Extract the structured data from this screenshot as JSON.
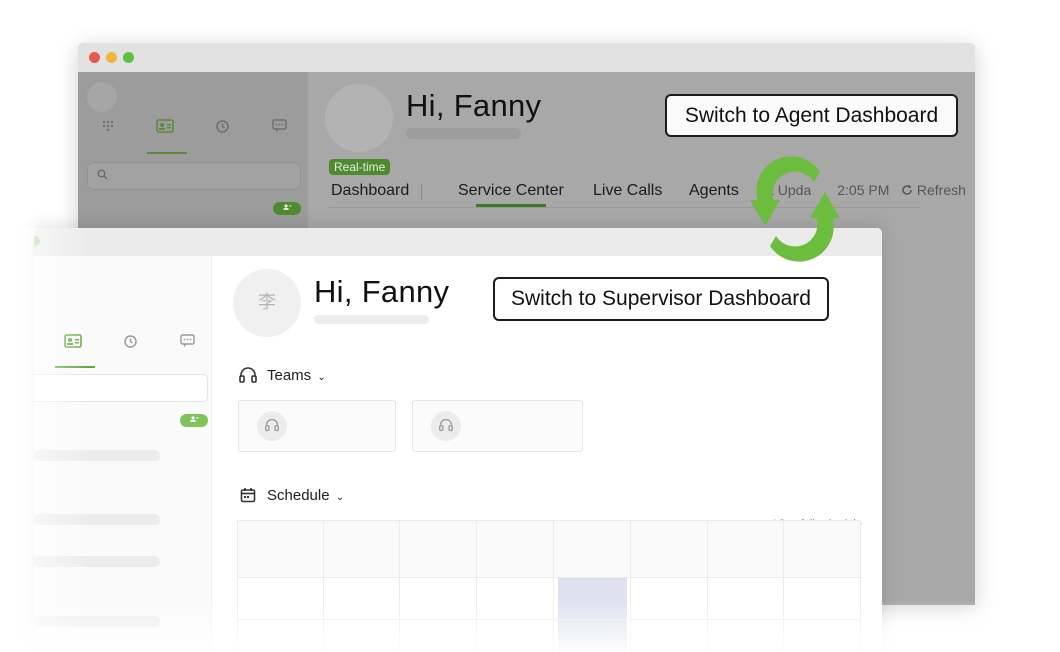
{
  "supervisor": {
    "greeting": "Hi, Fanny",
    "switch_button": "Switch to Agent Dashboard",
    "realtime_badge": "Real-time",
    "tabs": [
      "Dashboard",
      "Service Center",
      "Live Calls",
      "Agents"
    ],
    "active_tab": "Service Center",
    "last_updated": "st Upda",
    "last_updated_time": "2:05 PM",
    "refresh": "Refresh",
    "search_icon": "search-icon",
    "badge_icon": "add-icon"
  },
  "agent": {
    "greeting": "Hi, Fanny",
    "switch_button": "Switch to Supervisor Dashboard",
    "avatar_initial": "李",
    "teams_label": "Teams",
    "schedule_label": "Schedule",
    "view_full_schedule": "View full schedule"
  },
  "colors": {
    "accent_green": "#63a83f",
    "swap_green": "#6cbc3e",
    "back_overlay": "#a9a9a9",
    "schedule_highlight": "#dfe1ef"
  }
}
